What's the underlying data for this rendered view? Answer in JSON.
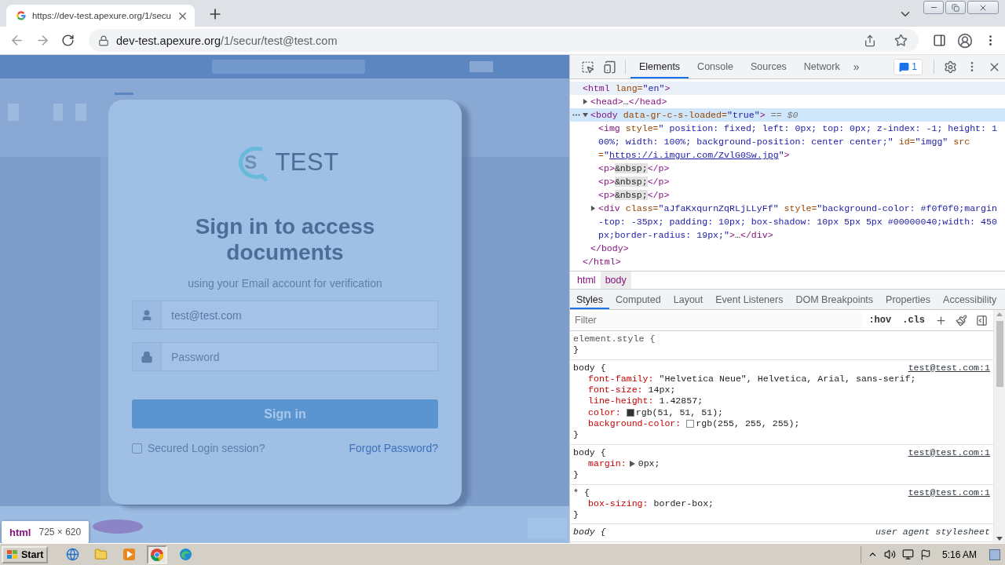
{
  "browser": {
    "tab": {
      "title": "https://dev-test.apexure.org/1/secu",
      "selected": true
    },
    "address": {
      "domain": "dev-test.apexure.org",
      "path": "/1/secur/test@test.com"
    }
  },
  "page": {
    "logo": {
      "letter": "S",
      "text": "TEST"
    },
    "heading": "Sign in to access documents",
    "subheading": "using your Email account for verification",
    "fields": [
      {
        "kind": "email",
        "value": "test@test.com"
      },
      {
        "kind": "password",
        "placeholder": "Password"
      }
    ],
    "submit": "Sign in",
    "remember": {
      "label": "Secured Login session?",
      "checked": false
    },
    "forgot_link": "Forgot Password?"
  },
  "hover_tooltip": {
    "tag": "html",
    "size": "725 × 620"
  },
  "devtools": {
    "tabs": [
      {
        "label": "Elements",
        "selected": true
      },
      {
        "label": "Console",
        "selected": false
      },
      {
        "label": "Sources",
        "selected": false
      },
      {
        "label": "Network",
        "selected": false
      }
    ],
    "overflow": "»",
    "issues_count": "1",
    "dom": {
      "markup": "<html lang=\"en\">",
      "close": "</html>",
      "hovered": true,
      "selected": false,
      "children": [
        {
          "markup": "<head>…</head>",
          "expanded": false,
          "hovered": false,
          "selected": false
        },
        {
          "markup": "<body data-gr-c-s-loaded=\"true\">",
          "suffix": "== $0",
          "close": "</body>",
          "expanded": true,
          "hovered": false,
          "selected": true,
          "children": [
            {
              "markup": "<img style=\" position: fixed; left: 0px; top: 0px; z-index: -1; height: 100%; width: 100%; background-position: center center;\" id=\"imgg\" src=\"",
              "link": "https://i.imgur.com/ZvlG0Sw.jpg",
              "markup_end": "\">",
              "hovered": false,
              "selected": false
            },
            {
              "markup": "<p>&nbsp;</p>",
              "hovered": false,
              "selected": false
            },
            {
              "markup": "<p>&nbsp;</p>",
              "hovered": false,
              "selected": false
            },
            {
              "markup": "<p>&nbsp;</p>",
              "hovered": false,
              "selected": false
            },
            {
              "markup": "<div class=\"aJfaKxqurnZqRLjLLyFf\" style=\"background-color: #f0f0f0;margin-top: -35px; padding: 10px; box-shadow: 10px 5px 5px #00000040;width: 450px;border-radius: 19px;\">…</div>",
              "expanded": false,
              "hovered": false,
              "selected": false
            }
          ]
        }
      ]
    },
    "breadcrumbs": [
      {
        "label": "html",
        "selected": false
      },
      {
        "label": "body",
        "selected": true
      }
    ],
    "pane_tabs": [
      {
        "label": "Styles",
        "selected": true
      },
      {
        "label": "Computed",
        "selected": false
      },
      {
        "label": "Layout",
        "selected": false
      },
      {
        "label": "Event Listeners",
        "selected": false
      },
      {
        "label": "DOM Breakpoints",
        "selected": false
      },
      {
        "label": "Properties",
        "selected": false
      },
      {
        "label": "Accessibility",
        "selected": false
      }
    ],
    "filter": {
      "placeholder": "Filter"
    },
    "filter_buttons": [
      ":hov",
      ".cls"
    ],
    "rules": [
      {
        "kind": "inline",
        "selector": "element.style {",
        "close": "}"
      },
      {
        "kind": "author",
        "selector": "body {",
        "source": "test@test.com:1",
        "close": "}",
        "declarations": [
          {
            "kind": "plain",
            "name": "font-family:",
            "value": "\"Helvetica Neue\", Helvetica, Arial, sans-serif;"
          },
          {
            "kind": "plain",
            "name": "font-size:",
            "value": "14px;"
          },
          {
            "kind": "plain",
            "name": "line-height:",
            "value": "1.42857;"
          },
          {
            "kind": "color",
            "name": "color:",
            "value": "rgb(51, 51, 51);",
            "color": "#333333"
          },
          {
            "kind": "color",
            "name": "background-color:",
            "value": "rgb(255, 255, 255);",
            "color": "#ffffff"
          }
        ]
      },
      {
        "kind": "author",
        "selector": "body {",
        "source": "test@test.com:1",
        "close": "}",
        "declarations": [
          {
            "kind": "shorthand",
            "name": "margin:",
            "value": "0px;"
          }
        ]
      },
      {
        "kind": "author",
        "selector": "* {",
        "source": "test@test.com:1",
        "close": "}",
        "declarations": [
          {
            "kind": "plain",
            "name": "box-sizing:",
            "value": "border-box;"
          }
        ]
      },
      {
        "kind": "user-agent",
        "selector": "body {",
        "source": "user agent stylesheet"
      }
    ]
  },
  "taskbar": {
    "start": "Start",
    "apps": [
      {
        "kind": "ie",
        "active": false
      },
      {
        "kind": "explorer",
        "active": false
      },
      {
        "kind": "media",
        "active": false
      },
      {
        "kind": "chrome",
        "active": true
      },
      {
        "kind": "edge",
        "active": false
      }
    ],
    "clock": "5:16 AM"
  }
}
